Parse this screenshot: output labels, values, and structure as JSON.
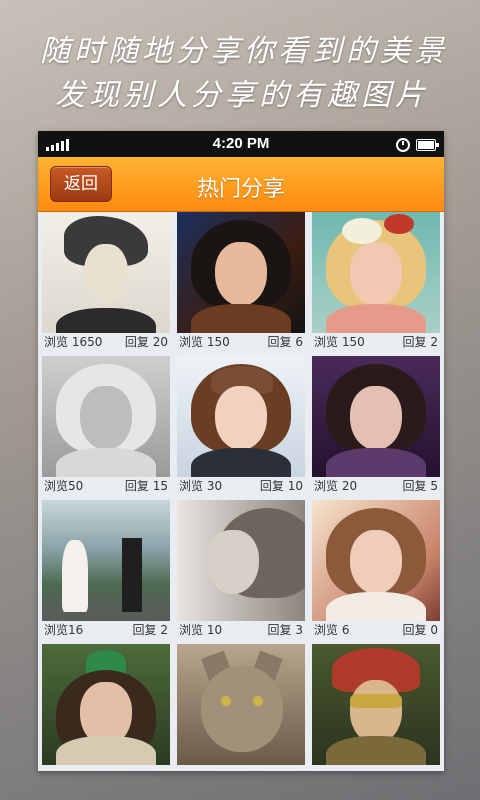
{
  "promo": {
    "line1": "随时随地分享你看到的美景",
    "line2": "发现别人分享的有趣图片"
  },
  "status_bar": {
    "time": "4:20 PM"
  },
  "header": {
    "back_label": "返回",
    "title": "热门分享"
  },
  "posts": [
    {
      "views": "浏览 1650",
      "replies": "回复 20",
      "image": "sketch-woman-with-bird"
    },
    {
      "views": "浏览 150",
      "replies": "回复 6",
      "image": "dark-haired-portrait"
    },
    {
      "views": "浏览 150",
      "replies": "回复 2",
      "image": "blonde-with-flowers"
    },
    {
      "views": "浏览50",
      "replies": "回复 15",
      "image": "grayscale-floral-portrait"
    },
    {
      "views": "浏览 30",
      "replies": "回复 10",
      "image": "girl-with-beanie"
    },
    {
      "views": "浏览 20",
      "replies": "回复 5",
      "image": "girl-in-purple-hood"
    },
    {
      "views": "浏览16",
      "replies": "回复 2",
      "image": "wedding-couple-mountains"
    },
    {
      "views": "浏览 10",
      "replies": "回复 3",
      "image": "sepia-profile-portrait"
    },
    {
      "views": "浏览 6",
      "replies": "回复 0",
      "image": "girl-in-sunlit-dress"
    },
    {
      "views": "",
      "replies": "",
      "image": "girl-in-green-hat-forest"
    },
    {
      "views": "",
      "replies": "",
      "image": "tabby-cat"
    },
    {
      "views": "",
      "replies": "",
      "image": "masked-carnival-figure"
    }
  ]
}
